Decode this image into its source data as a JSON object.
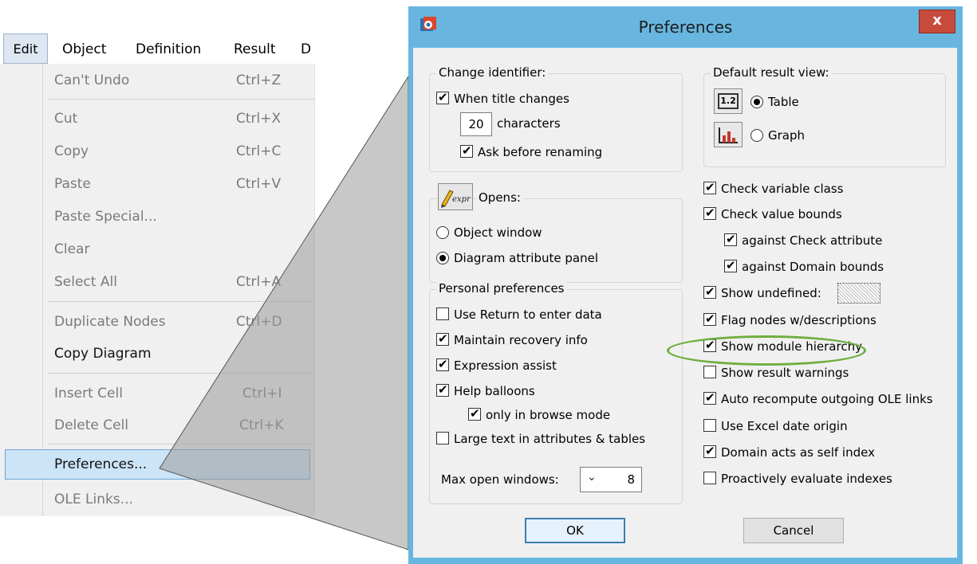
{
  "menubar": {
    "edit": "Edit",
    "object": "Object",
    "definition": "Definition",
    "result": "Result",
    "partial": "D"
  },
  "edit_menu": {
    "items": [
      {
        "label": "Can't Undo",
        "shortcut": "Ctrl+Z",
        "enabled": false
      },
      {
        "label": "Cut",
        "shortcut": "Ctrl+X",
        "enabled": false
      },
      {
        "label": "Copy",
        "shortcut": "Ctrl+C",
        "enabled": false
      },
      {
        "label": "Paste",
        "shortcut": "Ctrl+V",
        "enabled": false
      },
      {
        "label": "Paste Special...",
        "shortcut": "",
        "enabled": false
      },
      {
        "label": "Clear",
        "shortcut": "",
        "enabled": false
      },
      {
        "label": "Select All",
        "shortcut": "Ctrl+A",
        "enabled": false
      },
      {
        "label": "Duplicate Nodes",
        "shortcut": "Ctrl+D",
        "enabled": false
      },
      {
        "label": "Copy Diagram",
        "shortcut": "",
        "enabled": true
      },
      {
        "label": "Insert Cell",
        "shortcut": "Ctrl+I",
        "enabled": false
      },
      {
        "label": "Delete Cell",
        "shortcut": "Ctrl+K",
        "enabled": false
      },
      {
        "label": "Preferences...",
        "shortcut": "",
        "enabled": true
      },
      {
        "label": "OLE Links...",
        "shortcut": "",
        "enabled": false
      }
    ]
  },
  "dialog": {
    "title": "Preferences",
    "close_label": "x",
    "change_identifier": {
      "title": "Change identifier:",
      "when_title_changes": "When title changes",
      "characters_value": "20",
      "characters_label": "characters",
      "ask_before_renaming": "Ask before renaming"
    },
    "opens": {
      "title": "Opens:",
      "icon_text": "expr",
      "object_window": "Object window",
      "diagram_attribute_panel": "Diagram attribute panel"
    },
    "personal": {
      "title": "Personal preferences",
      "use_return": "Use Return to enter data",
      "maintain_recovery": "Maintain recovery info",
      "expression_assist": "Expression assist",
      "help_balloons": "Help balloons",
      "only_browse": "only in browse mode",
      "large_text": "Large text in attributes & tables",
      "max_open_label": "Max open windows:",
      "max_open_value": "8"
    },
    "default_result_view": {
      "title": "Default result view:",
      "table_icon": "1.2",
      "table": "Table",
      "graph": "Graph"
    },
    "right_checks": {
      "check_variable_class": "Check variable class",
      "check_value_bounds": "Check value bounds",
      "against_check_attribute": "against Check attribute",
      "against_domain_bounds": "against Domain bounds",
      "show_undefined": "Show undefined:",
      "flag_nodes": "Flag nodes w/descriptions",
      "show_module_hierarchy": "Show module hierarchy",
      "show_result_warnings": "Show result warnings",
      "auto_recompute": "Auto recompute outgoing OLE links",
      "use_excel_date": "Use Excel date origin",
      "domain_self_index": "Domain acts as self index",
      "proactively_evaluate": "Proactively evaluate indexes"
    },
    "ok_label": "OK",
    "cancel_label": "Cancel"
  },
  "colors": {
    "dialog_frame": "#68b6e0",
    "close_button": "#c74b3c",
    "highlight_ellipse": "#6fae3f",
    "menu_selection": "#cce4f7"
  }
}
